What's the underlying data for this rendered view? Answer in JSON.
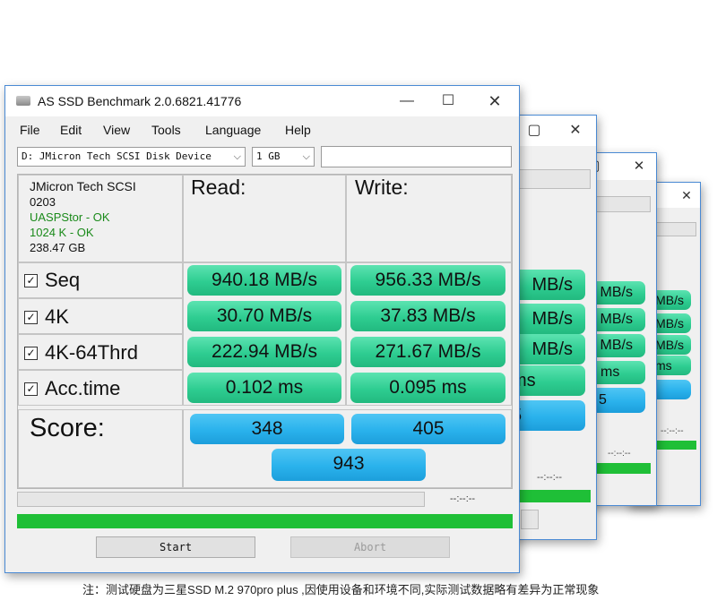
{
  "windows_back": [
    {
      "read_seq": "MB/s",
      "read_4k": "MB/s",
      "read_4k64": "MB/s",
      "read_acc": "ms",
      "score": "5",
      "timer": "--:--:--"
    },
    {
      "read_seq": "MB/s",
      "read_4k": "MB/s",
      "read_4k64": "MB/s",
      "read_acc": "ms",
      "score": "5",
      "timer": "--:--:--"
    },
    {
      "read_seq": "MB/s",
      "read_4k": "MB/s",
      "read_4k64": "MB/s",
      "read_acc": "ms",
      "score": "5",
      "timer": "--:--:--"
    }
  ],
  "window": {
    "title": "AS SSD Benchmark 2.0.6821.41776",
    "menu": [
      "File",
      "Edit",
      "View",
      "Tools",
      "Language",
      "Help"
    ],
    "drive_select": "D: JMicron Tech SCSI Disk Device",
    "size_select": "1 GB",
    "device": {
      "name": "JMicron Tech SCSI",
      "firmware": "0203",
      "driver": "UASPStor - OK",
      "alignment": "1024 K - OK",
      "capacity": "238.47 GB"
    },
    "headers": {
      "read": "Read:",
      "write": "Write:"
    },
    "rows": [
      {
        "label": "Seq",
        "read": "940.18 MB/s",
        "write": "956.33 MB/s"
      },
      {
        "label": "4K",
        "read": "30.70 MB/s",
        "write": "37.83 MB/s"
      },
      {
        "label": "4K-64Thrd",
        "read": "222.94 MB/s",
        "write": "271.67 MB/s"
      },
      {
        "label": "Acc.time",
        "read": "0.102 ms",
        "write": "0.095 ms"
      }
    ],
    "score_label": "Score:",
    "score_read": "348",
    "score_write": "405",
    "score_total": "943",
    "timer": "--:--:--",
    "buttons": {
      "start": "Start",
      "abort": "Abort"
    }
  },
  "footnote": "注：测试硬盘为三星SSD M.2 970pro  plus ,因使用设备和环境不同,实际测试数据略有差异为正常现象",
  "colors": {
    "accent_border": "#4a8ad4",
    "result_green": "#2ecd91",
    "score_blue": "#2ab2ec",
    "progress_green": "#1fbf37"
  }
}
